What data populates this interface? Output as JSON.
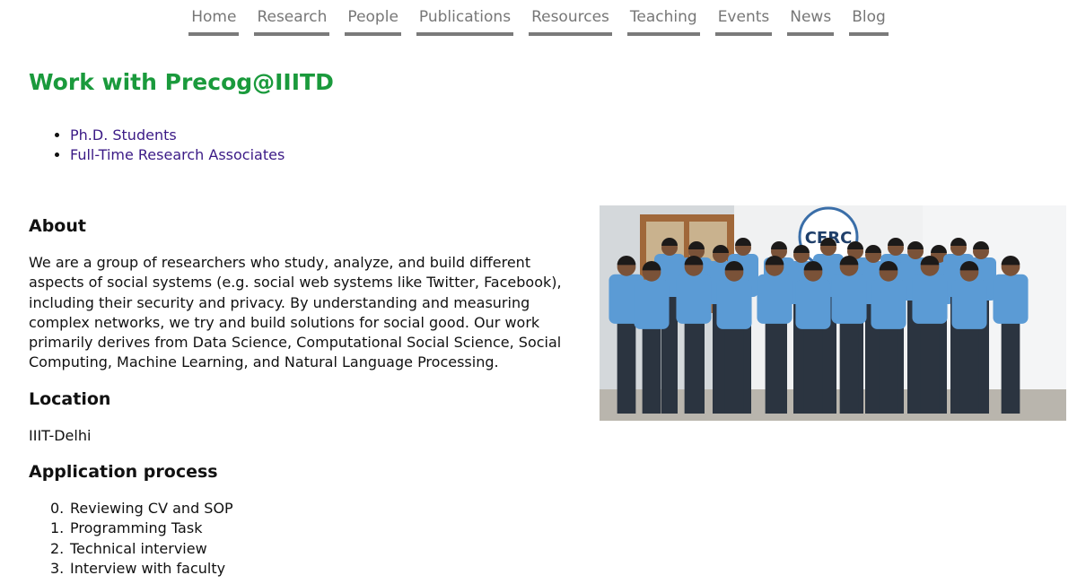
{
  "nav": {
    "items": [
      {
        "label": "Home"
      },
      {
        "label": "Research"
      },
      {
        "label": "People"
      },
      {
        "label": "Publications"
      },
      {
        "label": "Resources"
      },
      {
        "label": "Teaching"
      },
      {
        "label": "Events"
      },
      {
        "label": "News"
      },
      {
        "label": "Blog"
      }
    ]
  },
  "page_title": "Work with Precog@IIITD",
  "opportunities": [
    {
      "label": "Ph.D. Students"
    },
    {
      "label": "Full-Time Research Associates"
    }
  ],
  "about": {
    "heading": "About",
    "text": "We are a group of researchers who study, analyze, and build different aspects of social systems (e.g. social web systems like Twitter, Facebook), including their security and privacy. By understanding and measuring complex networks, we try and build solutions for social good. Our work primarily derives from Data Science, Computational Social Science, Social Computing, Machine Learning, and Natural Language Processing."
  },
  "location": {
    "heading": "Location",
    "text": "IIIT-Delhi"
  },
  "application": {
    "heading": "Application process",
    "steps": [
      {
        "num": "0.",
        "label": "Reviewing CV and SOP"
      },
      {
        "num": "1.",
        "label": "Programming Task"
      },
      {
        "num": "2.",
        "label": "Technical interview"
      },
      {
        "num": "3.",
        "label": "Interview with faculty"
      }
    ]
  },
  "photo": {
    "banner_text": "CERC",
    "colors": {
      "shirt": "#5b9bd5",
      "wall": "#e9ecee",
      "door": "#a0683a",
      "title": "#1a9a3c",
      "link": "#3b1a86"
    }
  }
}
